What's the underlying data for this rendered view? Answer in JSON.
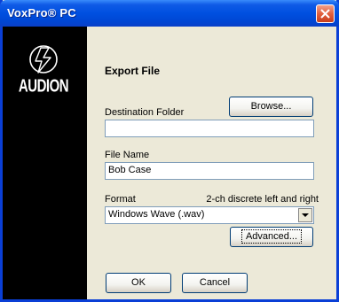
{
  "window": {
    "title": "VoxPro® PC"
  },
  "logo": {
    "brand": "AUDION"
  },
  "dialog": {
    "heading": "Export File",
    "destination_label": "Destination Folder",
    "destination_value": "",
    "browse_label": "Browse...",
    "filename_label": "File Name",
    "filename_value": "Bob Case",
    "format_label": "Format",
    "format_channels": "2-ch discrete left and right",
    "format_selected": "Windows Wave (.wav)",
    "advanced_label": "Advanced...",
    "ok_label": "OK",
    "cancel_label": "Cancel"
  }
}
